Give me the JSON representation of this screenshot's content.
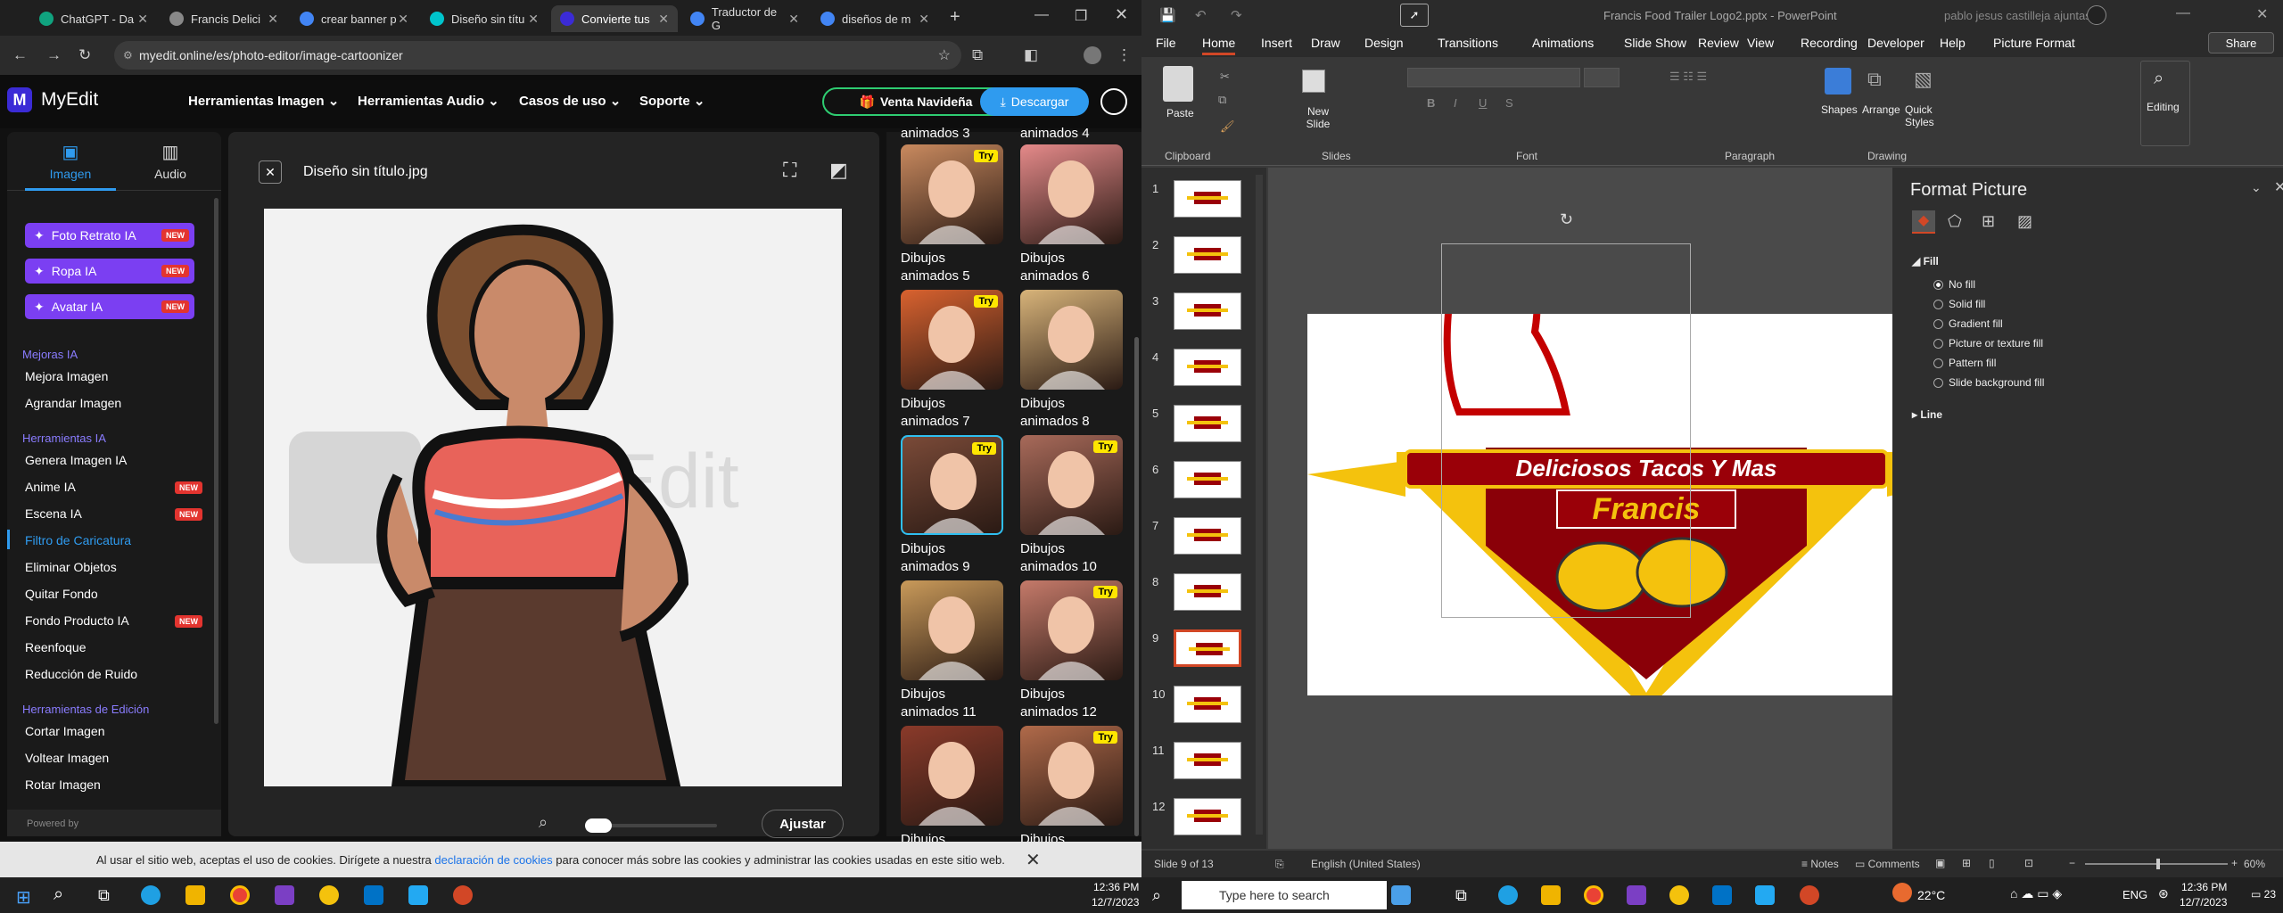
{
  "browser": {
    "tabs": [
      {
        "title": "ChatGPT - Da",
        "color": "#10a37f"
      },
      {
        "title": "Francis Delici",
        "color": "#888"
      },
      {
        "title": "crear banner p",
        "color": "#4285f4"
      },
      {
        "title": "Diseño sin títu",
        "color": "#00c4cc"
      },
      {
        "title": "Convierte tus",
        "color": "#3b2bd6"
      },
      {
        "title": "Traductor de G",
        "color": "#4285f4"
      },
      {
        "title": "diseños de m",
        "color": "#4285f4"
      }
    ],
    "url": "myedit.online/es/photo-editor/image-cartoonizer"
  },
  "myedit": {
    "logo": "MyEdit",
    "menu": [
      "Herramientas Imagen",
      "Herramientas Audio",
      "Casos de uso",
      "Soporte"
    ],
    "promo_button": "Venta Navideña",
    "download_button": "Descargar",
    "side_tabs": [
      "Imagen",
      "Audio"
    ],
    "ai_buttons": [
      "Foto Retrato IA",
      "Ropa IA",
      "Avatar IA"
    ],
    "new_label": "NEW",
    "sections": {
      "mejoras": "Mejoras IA",
      "mejoras_items": [
        "Mejora Imagen",
        "Agrandar Imagen"
      ],
      "herramientas_ia": "Herramientas IA",
      "ia_items": [
        "Genera Imagen IA",
        "Anime IA",
        "Escena IA",
        "Filtro de Caricatura",
        "Eliminar Objetos",
        "Quitar Fondo",
        "Fondo Producto IA",
        "Reenfoque",
        "Reducción de Ruido"
      ],
      "edicion": "Herramientas de Edición",
      "edicion_items": [
        "Cortar Imagen",
        "Voltear Imagen",
        "Rotar Imagen"
      ]
    },
    "powered_by": "Powered by",
    "file_name": "Diseño sin título.jpg",
    "watermark": "MyEdit",
    "apply_button": "Ajustar",
    "try_label": "Try",
    "styles": [
      {
        "l1": "Dibujos",
        "l2": "animados 5",
        "try": true,
        "color": "#c98a5f"
      },
      {
        "l1": "Dibujos",
        "l2": "animados 6",
        "try": false,
        "color": "#e58a8a"
      },
      {
        "l1": "Dibujos",
        "l2": "animados 7",
        "try": true,
        "color": "#d9622f"
      },
      {
        "l1": "Dibujos",
        "l2": "animados 8",
        "try": false,
        "color": "#d8b47a"
      },
      {
        "l1": "Dibujos",
        "l2": "animados 9",
        "try": true,
        "color": "#7a4a38"
      },
      {
        "l1": "Dibujos",
        "l2": "animados 10",
        "try": true,
        "color": "#a86a5a"
      },
      {
        "l1": "Dibujos",
        "l2": "animados 11",
        "try": false,
        "color": "#c99a5a"
      },
      {
        "l1": "Dibujos",
        "l2": "animados 12",
        "try": true,
        "color": "#c57a6a"
      },
      {
        "l1": "Dibujos",
        "l2": "",
        "try": false,
        "color": "#8a3a2a"
      },
      {
        "l1": "Dibujos",
        "l2": "",
        "try": true,
        "color": "#b06a4a"
      }
    ],
    "partial_labels": [
      "animados 3",
      "animados 4"
    ],
    "cookie_text": "Al usar el sitio web, aceptas el uso de cookies. Dirígete a nuestra",
    "cookie_link": "declaración de cookies",
    "cookie_tail": "para conocer más sobre las cookies y administrar las cookies usadas en este sitio web."
  },
  "ppt": {
    "title": "Francis Food Trailer Logo2.pptx - PowerPoint",
    "user": "pablo jesus castilleja ajuntas",
    "tabs": [
      "File",
      "Home",
      "Insert",
      "Draw",
      "Design",
      "Transitions",
      "Animations",
      "Slide Show",
      "Review",
      "View",
      "Recording",
      "Developer",
      "Help",
      "Picture Format"
    ],
    "share": "Share",
    "groups": [
      "Clipboard",
      "Slides",
      "Font",
      "Paragraph",
      "Drawing"
    ],
    "paste": "Paste",
    "new_slide": "New Slide",
    "shapes": "Shapes",
    "arrange": "Arrange",
    "quick_styles": "Quick Styles",
    "editing": "Editing",
    "slide_numbers": [
      "1",
      "2",
      "3",
      "4",
      "5",
      "6",
      "7",
      "8",
      "9",
      "10",
      "11",
      "12"
    ],
    "logo_line1": "Deliciosos Tacos Y Mas",
    "logo_line2": "Francis",
    "format_title": "Format Picture",
    "fill_section": "Fill",
    "fill_options": [
      "No fill",
      "Solid fill",
      "Gradient fill",
      "Picture or texture fill",
      "Pattern fill",
      "Slide background fill"
    ],
    "line_section": "Line",
    "status_slide": "Slide 9 of 13",
    "status_lang": "English (United States)",
    "notes": "Notes",
    "comments": "Comments",
    "zoom": "60%"
  },
  "taskbar": {
    "left_time": "12:36 PM",
    "left_date": "12/7/2023",
    "search": "Type here to search",
    "weather": "22°C",
    "lang": "ENG",
    "right_time": "12:36 PM",
    "right_date": "12/7/2023",
    "notif": "23"
  }
}
